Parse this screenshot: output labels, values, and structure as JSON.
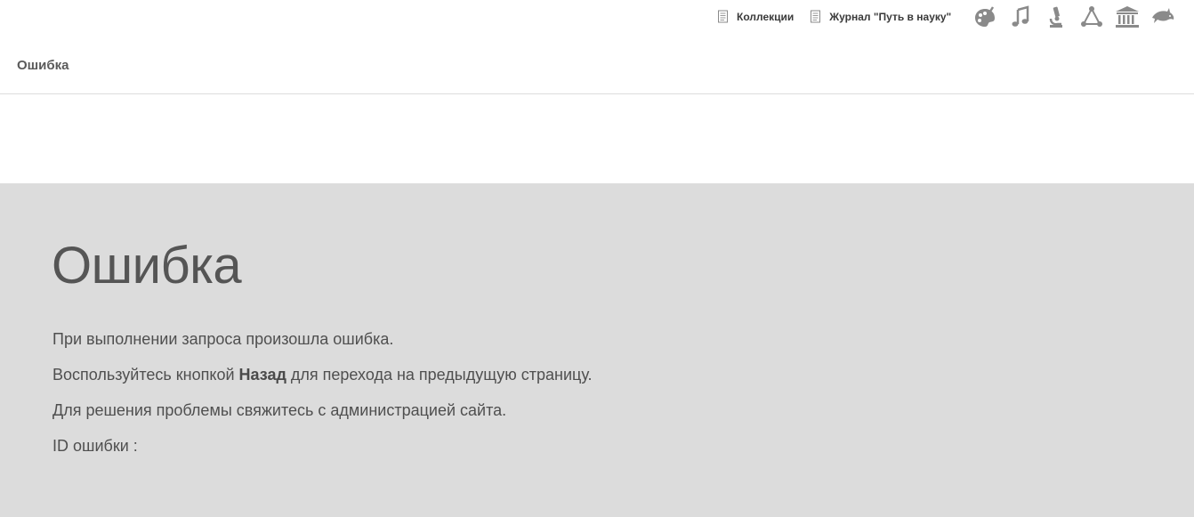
{
  "topbar": {
    "links": [
      {
        "label": "Коллекции",
        "icon": "document-icon"
      },
      {
        "label": "Журнал \"Путь в науку\"",
        "icon": "document-icon"
      }
    ],
    "site_icons": [
      "palette-icon",
      "music-note-icon",
      "microscope-icon",
      "molecule-icon",
      "museum-icon",
      "dolphin-icon"
    ],
    "icon_color": "#8a8a8a"
  },
  "header": {
    "title": "Ошибка"
  },
  "error": {
    "heading": "Ошибка",
    "line1": "При выполнении запроса произошла ошибка.",
    "line2_prefix": "Воспользуйтесь кнопкой ",
    "line2_bold": "Назад",
    "line2_suffix": " для перехода на предыдущую страницу.",
    "line3": "Для решения проблемы свяжитесь с администрацией сайта.",
    "line4": "ID ошибки :",
    "panel_color": "#dcdcdc"
  }
}
